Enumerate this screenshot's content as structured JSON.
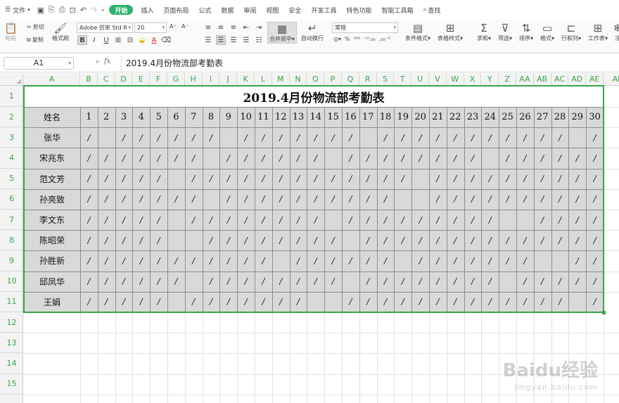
{
  "menubar": {
    "file": "文件",
    "tabs": [
      "开始",
      "插入",
      "页面布局",
      "公式",
      "数据",
      "审阅",
      "视图",
      "安全",
      "开发工具",
      "特色功能",
      "智能工具箱"
    ],
    "active_tab": "开始",
    "search": "查找"
  },
  "toolbar": {
    "paste": "粘贴",
    "cut": "剪切",
    "copy": "复制",
    "format_painter": "格式刷",
    "font_name": "Adobe 仿宋 Std R",
    "font_size": "20",
    "bold": "B",
    "italic": "I",
    "underline": "U",
    "merge_center": "合并居中",
    "wrap": "自动换行",
    "number_format": "常规",
    "percent": "%",
    "conditional_format": "条件格式",
    "table_style": "表格样式",
    "sum": "求和",
    "filter": "筛选",
    "sort": "排序",
    "format": "格式",
    "rows_cols": "行和列",
    "worksheet": "工作表",
    "more": "冻"
  },
  "formula_bar": {
    "cell_ref": "A1",
    "fx": "fx",
    "content": "2019.4月份物流部考勤表"
  },
  "sheet": {
    "columns": [
      "A",
      "B",
      "C",
      "D",
      "E",
      "F",
      "G",
      "H",
      "I",
      "J",
      "K",
      "L",
      "M",
      "N",
      "O",
      "P",
      "Q",
      "R",
      "S",
      "T",
      "U",
      "V",
      "W",
      "X",
      "Y",
      "Z",
      "AA",
      "AB",
      "AC",
      "AD",
      "AE",
      "AF"
    ],
    "rows": [
      "1",
      "2",
      "3",
      "4",
      "5",
      "6",
      "7",
      "8",
      "9",
      "10",
      "11",
      "12",
      "13",
      "14",
      "15"
    ],
    "title": "2019.4月份物流部考勤表",
    "name_header": "姓名",
    "days": [
      "1",
      "2",
      "3",
      "4",
      "5",
      "6",
      "7",
      "8",
      "9",
      "10",
      "11",
      "12",
      "13",
      "14",
      "15",
      "16",
      "17",
      "18",
      "19",
      "20",
      "21",
      "22",
      "23",
      "24",
      "25",
      "26",
      "27",
      "28",
      "29",
      "30"
    ],
    "mark": "/",
    "employees": [
      {
        "name": "张华",
        "marks": "1011111101111111011111111111011"
      },
      {
        "name": "宋兆东",
        "marks": "1111111011111101111111101111111"
      },
      {
        "name": "范文芳",
        "marks": "1111101111111111111011111111111"
      },
      {
        "name": "孙亮致",
        "marks": "1111111011111111110011111111111"
      },
      {
        "name": "李文东",
        "marks": "1111101111111101111111110011111"
      },
      {
        "name": "陈昭荣",
        "marks": "1111100111111110111111111111111"
      },
      {
        "name": "孙胜新",
        "marks": "1111111111101111110111111100111"
      },
      {
        "name": "邱凤华",
        "marks": "1111110111111110111111110111111"
      },
      {
        "name": "王娟",
        "marks": "1111101111111001111111111111011"
      }
    ]
  },
  "watermark": {
    "brand": "Baidu经验",
    "url": "jingyan.baidu.com"
  }
}
